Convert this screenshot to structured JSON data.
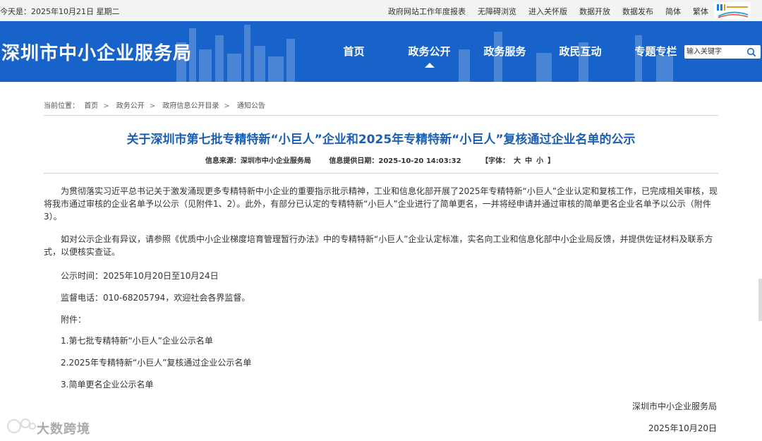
{
  "topbar": {
    "today": "今天是：2025年10月21日 星期二",
    "links": [
      "政府网站工作年度报表",
      "无障碍浏览",
      "进入关怀版",
      "数据开放",
      "数据发布",
      "简体",
      "繁体"
    ]
  },
  "header": {
    "site_title": "深圳市中小企业服务局",
    "nav": [
      "首页",
      "政务公开",
      "政务服务",
      "政民互动",
      "专题专栏"
    ],
    "active_nav": "政务公开",
    "search_placeholder": "输入关键字",
    "brand_color": "#1763c9"
  },
  "breadcrumb": {
    "label": "当前位置：",
    "items": [
      "首页",
      "政务公开",
      "政府信息公开目录",
      "通知公告"
    ]
  },
  "article": {
    "title": "关于深圳市第七批专精特新“小巨人”企业和2025年专精特新“小巨人”复核通过企业名单的公示",
    "source": "信息来源：深圳市中小企业服务局",
    "date": "信息提供日期：2025-10-20 14:03:32",
    "font_label": "【字体：",
    "font_sizes": [
      "大",
      "中",
      "小"
    ],
    "font_close": "】",
    "paragraph1": "为贯彻落实习近平总书记关于激发涌现更多专精特新中小企业的重要指示批示精神，工业和信息化部开展了2025年专精特新“小巨人”企业认定和复核工作，已完成相关审核，现将我市通过审核的企业名单予以公示（见附件1、2）。此外，有部分已认定的专精特新“小巨人”企业进行了简单更名，一并将经申请并通过审核的简单更名企业名单予以公示（附件3）。",
    "paragraph2": "如对公示企业有异议，请参照《优质中小企业梯度培育管理暂行办法》中的专精特新“小巨人”企业认定标准，实名向工业和信息化部中小企业局反馈，并提供佐证材料及联系方式，以便核实查证。",
    "period": "公示时间：2025年10月20日至10月24日",
    "phone": "监督电话：010-68205794，欢迎社会各界监督。",
    "attachments_label": "附件：",
    "attachments": [
      "1.第七批专精特新“小巨人”企业公示名单",
      "2.2025年专精特新“小巨人”复核通过企业公示名单",
      "3.简单更名企业公示名单"
    ],
    "signature": "深圳市中小企业服务局",
    "sign_date": "2025年10月20日"
  },
  "watermark": "大数跨境"
}
